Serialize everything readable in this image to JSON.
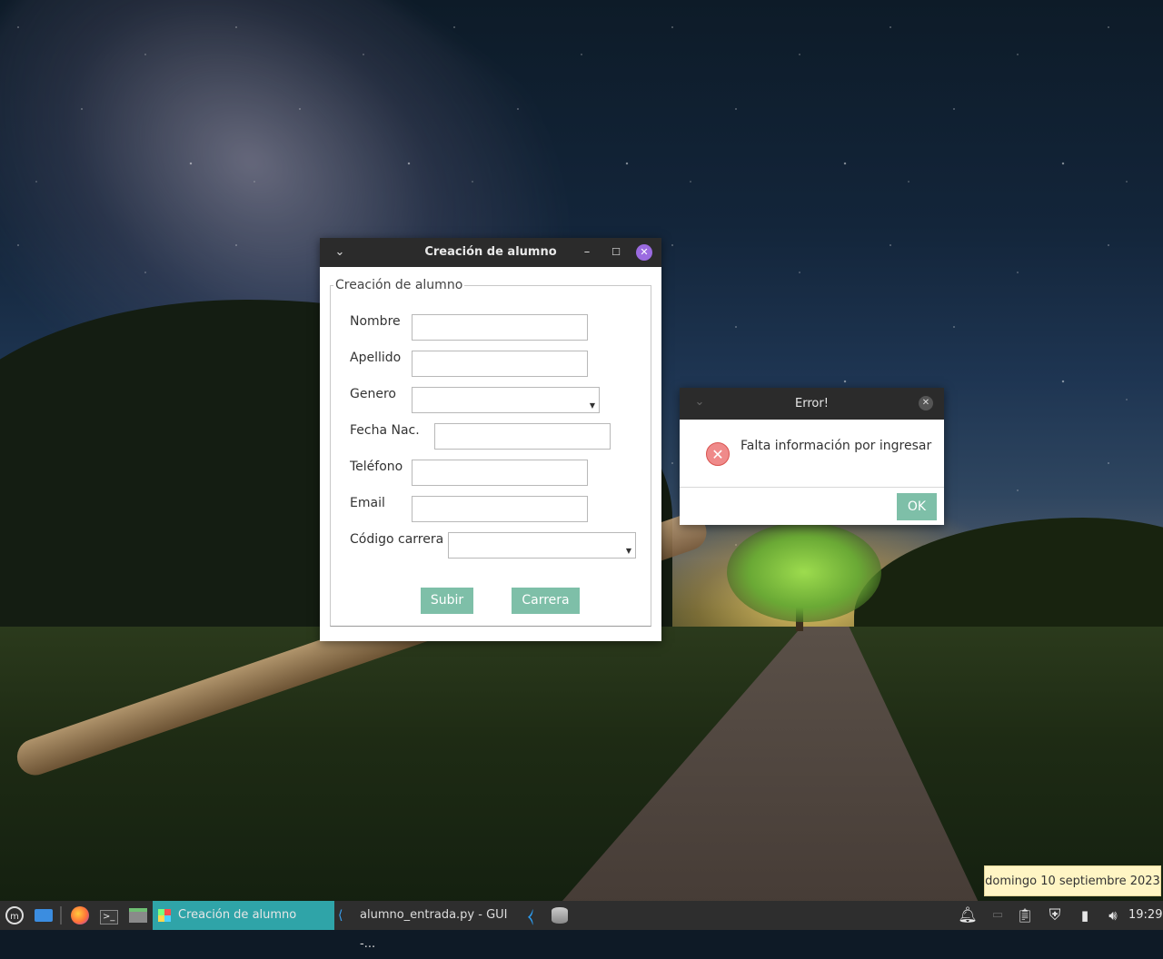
{
  "main_window": {
    "title": "Creación de alumno",
    "group_title": "Creación de alumno",
    "fields": {
      "nombre_label": "Nombre",
      "apellido_label": "Apellido",
      "genero_label": "Genero",
      "fecha_label": "Fecha Nac.",
      "telefono_label": "Teléfono",
      "email_label": "Email",
      "codigo_label": "Código carrera"
    },
    "buttons": {
      "subir": "Subir",
      "carrera": "Carrera"
    }
  },
  "error_dialog": {
    "title": "Error!",
    "message": "Falta información por ingresar",
    "ok_label": "OK"
  },
  "taskbar": {
    "active_task": "Creación de alumno",
    "second_task": "alumno_entrada.py - GUI -...",
    "clock": "19:29",
    "date_tooltip": "domingo 10 septiembre 2023"
  },
  "colors": {
    "accent_button": "#7ebfa8",
    "active_task": "#2fa4a8",
    "close_button": "#9b6be0",
    "error_icon": "#ef8a8a"
  }
}
